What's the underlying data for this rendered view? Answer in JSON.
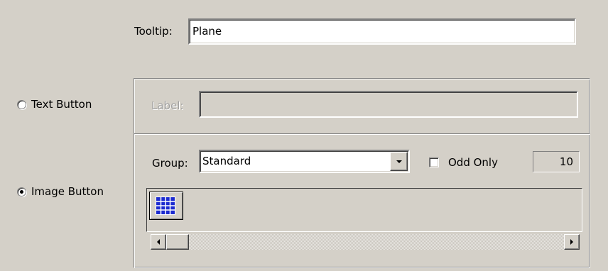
{
  "tooltip": {
    "label": "Tooltip:",
    "value": "Plane"
  },
  "text_button": {
    "radio_label": "Text Button",
    "selected": false,
    "label_field": {
      "label": "Label:",
      "value": ""
    }
  },
  "image_button": {
    "radio_label": "Image Button",
    "selected": true
  },
  "group": {
    "label": "Group:",
    "selected": "Standard"
  },
  "odd_only": {
    "label": "Odd Only",
    "checked": false
  },
  "count": "10",
  "icons": {
    "selected_icon": "grid-icon"
  },
  "colors": {
    "face": "#d4d0c8",
    "icon_blue": "#1c2bd0"
  }
}
